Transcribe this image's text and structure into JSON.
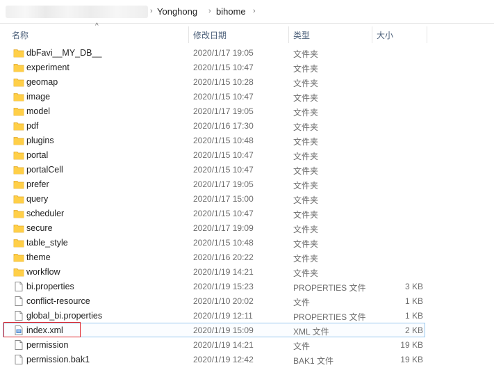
{
  "breadcrumb": {
    "items": [
      "Yonghong",
      "bihome"
    ]
  },
  "columns": {
    "name": "名称",
    "date": "修改日期",
    "type": "类型",
    "size": "大小"
  },
  "colors": {
    "folder": "#ffcf48",
    "folder_dark": "#e2a824",
    "selection_border": "#99c8ee",
    "annotation_red": "#e0242a"
  },
  "files": [
    {
      "name": "dbFavi__MY_DB__",
      "date": "2020/1/17 19:05",
      "type": "文件夹",
      "size": "",
      "icon": "folder-icon"
    },
    {
      "name": "experiment",
      "date": "2020/1/15 10:47",
      "type": "文件夹",
      "size": "",
      "icon": "folder-icon"
    },
    {
      "name": "geomap",
      "date": "2020/1/15 10:28",
      "type": "文件夹",
      "size": "",
      "icon": "folder-icon"
    },
    {
      "name": "image",
      "date": "2020/1/15 10:47",
      "type": "文件夹",
      "size": "",
      "icon": "folder-icon"
    },
    {
      "name": "model",
      "date": "2020/1/17 19:05",
      "type": "文件夹",
      "size": "",
      "icon": "folder-icon"
    },
    {
      "name": "pdf",
      "date": "2020/1/16 17:30",
      "type": "文件夹",
      "size": "",
      "icon": "folder-icon"
    },
    {
      "name": "plugins",
      "date": "2020/1/15 10:48",
      "type": "文件夹",
      "size": "",
      "icon": "folder-icon"
    },
    {
      "name": "portal",
      "date": "2020/1/15 10:47",
      "type": "文件夹",
      "size": "",
      "icon": "folder-icon"
    },
    {
      "name": "portalCell",
      "date": "2020/1/15 10:47",
      "type": "文件夹",
      "size": "",
      "icon": "folder-icon"
    },
    {
      "name": "prefer",
      "date": "2020/1/17 19:05",
      "type": "文件夹",
      "size": "",
      "icon": "folder-icon"
    },
    {
      "name": "query",
      "date": "2020/1/17 15:00",
      "type": "文件夹",
      "size": "",
      "icon": "folder-icon"
    },
    {
      "name": "scheduler",
      "date": "2020/1/15 10:47",
      "type": "文件夹",
      "size": "",
      "icon": "folder-icon"
    },
    {
      "name": "secure",
      "date": "2020/1/17 19:09",
      "type": "文件夹",
      "size": "",
      "icon": "folder-icon"
    },
    {
      "name": "table_style",
      "date": "2020/1/15 10:48",
      "type": "文件夹",
      "size": "",
      "icon": "folder-icon"
    },
    {
      "name": "theme",
      "date": "2020/1/16 20:22",
      "type": "文件夹",
      "size": "",
      "icon": "folder-icon"
    },
    {
      "name": "workflow",
      "date": "2020/1/19 14:21",
      "type": "文件夹",
      "size": "",
      "icon": "folder-icon"
    },
    {
      "name": "bi.properties",
      "date": "2020/1/19 15:23",
      "type": "PROPERTIES 文件",
      "size": "3 KB",
      "icon": "file-icon"
    },
    {
      "name": "conflict-resource",
      "date": "2020/1/10 20:02",
      "type": "文件",
      "size": "1 KB",
      "icon": "file-icon"
    },
    {
      "name": "global_bi.properties",
      "date": "2020/1/19 12:11",
      "type": "PROPERTIES 文件",
      "size": "1 KB",
      "icon": "file-icon"
    },
    {
      "name": "index.xml",
      "date": "2020/1/19 15:09",
      "type": "XML 文件",
      "size": "2 KB",
      "icon": "xml-file-icon",
      "selected": true
    },
    {
      "name": "permission",
      "date": "2020/1/19 14:21",
      "type": "文件",
      "size": "19 KB",
      "icon": "file-icon"
    },
    {
      "name": "permission.bak1",
      "date": "2020/1/19 12:42",
      "type": "BAK1 文件",
      "size": "19 KB",
      "icon": "file-icon"
    }
  ]
}
